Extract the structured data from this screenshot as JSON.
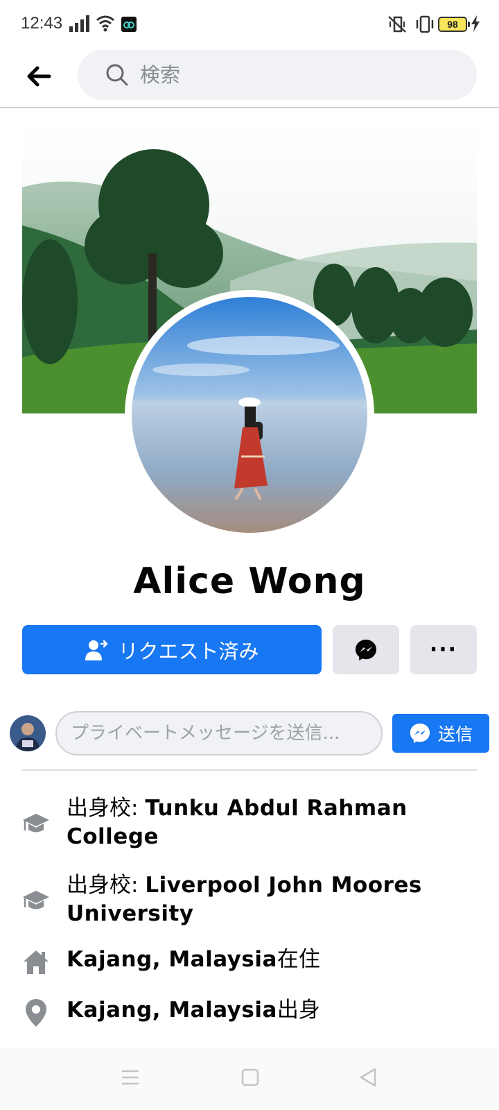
{
  "status_bar": {
    "time": "12:43",
    "battery": "98"
  },
  "search": {
    "placeholder": "検索"
  },
  "profile": {
    "name": "Alice Wong"
  },
  "actions": {
    "request_label": "リクエスト済み",
    "more_label": "···"
  },
  "message": {
    "placeholder": "プライベートメッセージを送信...",
    "send_label": "送信"
  },
  "intro": {
    "education": [
      {
        "prefix": "出身校: ",
        "school": "Tunku Abdul Rahman College"
      },
      {
        "prefix": "出身校: ",
        "school": "Liverpool John Moores University"
      }
    ],
    "lives_in": {
      "place": "Kajang, Malaysia",
      "suffix": "在住"
    },
    "from": {
      "place": "Kajang, Malaysia",
      "suffix": "出身"
    }
  },
  "icons": {
    "back": "arrow-left-icon",
    "search": "search-icon",
    "add_friend": "person-arrow-icon",
    "messenger": "messenger-icon",
    "education": "graduation-cap-icon",
    "home": "home-icon",
    "location": "map-pin-icon"
  },
  "colors": {
    "accent": "#1877f2",
    "secondary_button": "#e4e6eb",
    "icon_gray": "#8a8d91"
  }
}
